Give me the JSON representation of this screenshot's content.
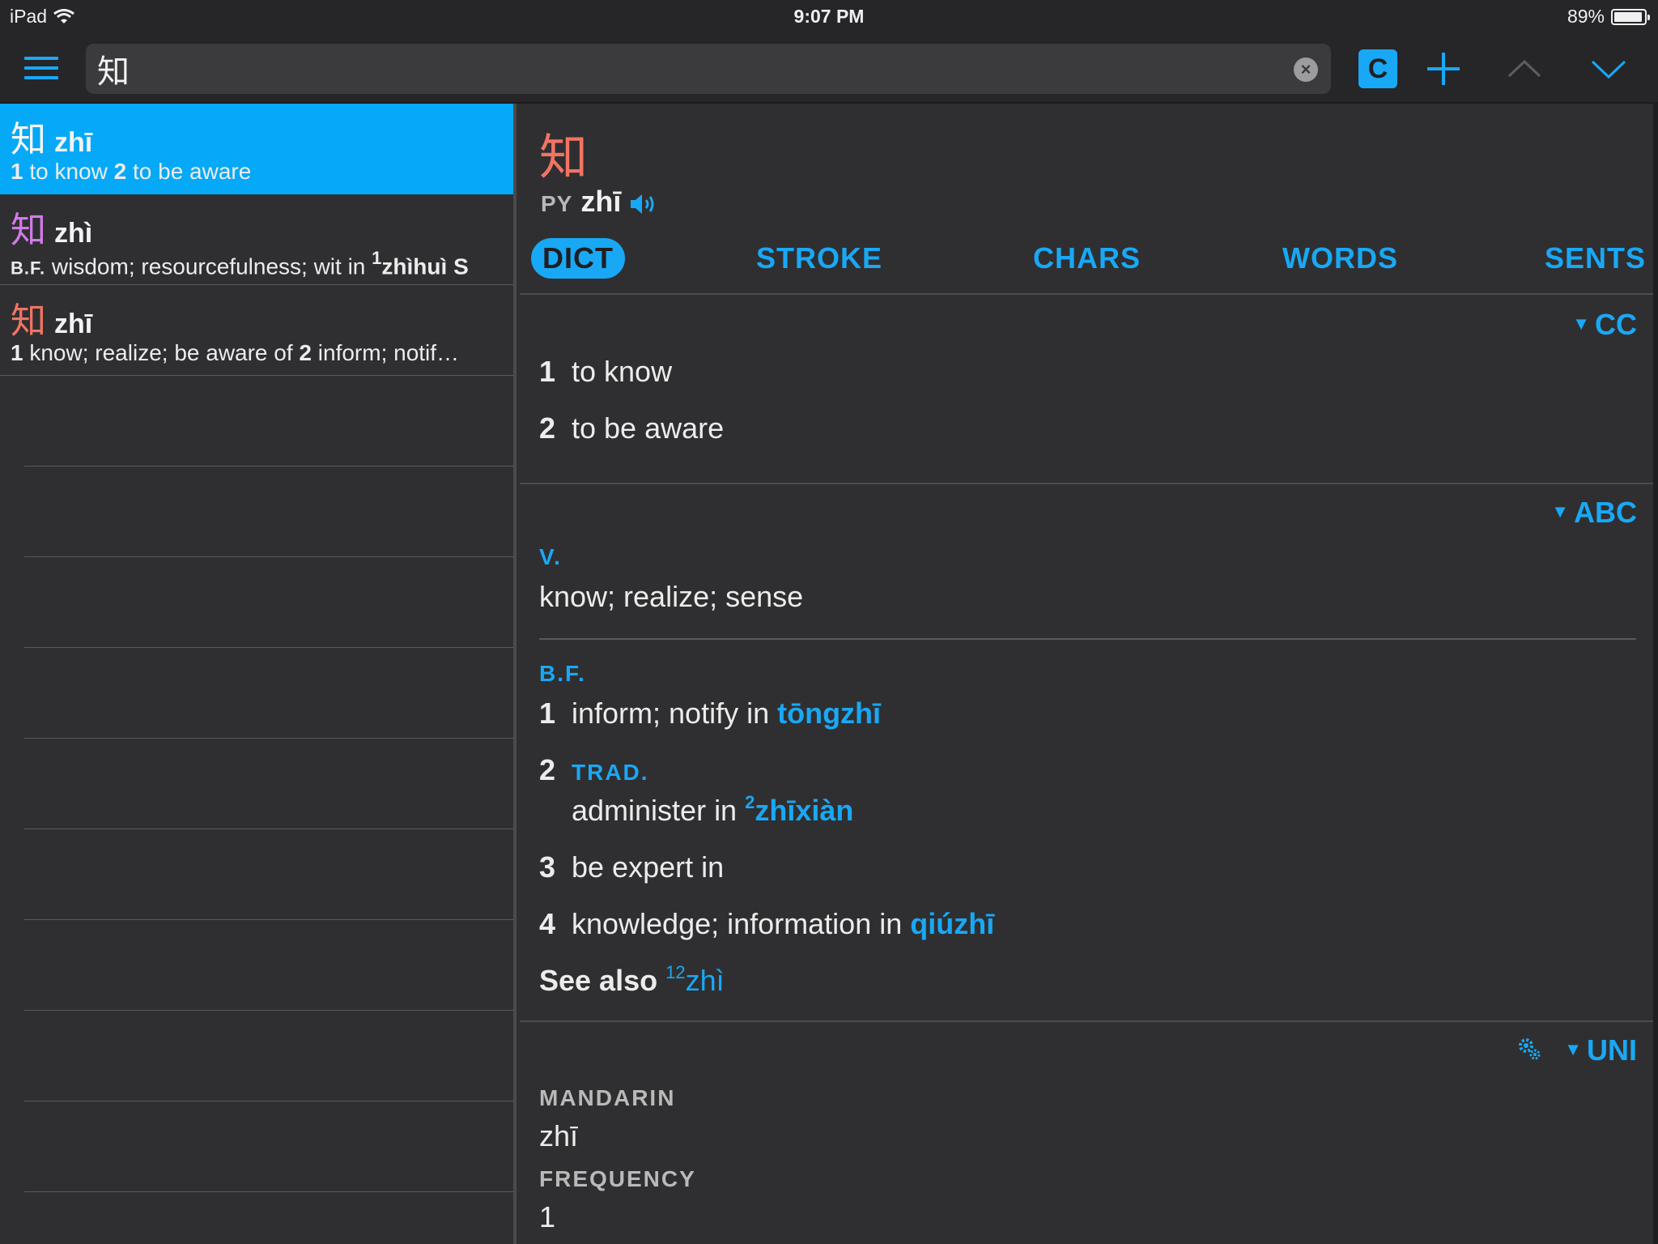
{
  "status": {
    "device": "iPad",
    "time": "9:07 PM",
    "battery": "89%"
  },
  "toolbar": {
    "query": "知",
    "c_button": "C"
  },
  "results": [
    {
      "hanzi": "知",
      "hanzi_color": "#f7f7f7",
      "pinyin": "zhī",
      "def_html_parts": {
        "n1": "1",
        "t1": " to know  ",
        "n2": "2",
        "t2": " to be aware"
      }
    },
    {
      "hanzi": "知",
      "hanzi_color": "#d27ae8",
      "pinyin": "zhì",
      "def_parts": {
        "tag": "B.F.",
        "t1": " wisdom; resourcefulness; wit in ",
        "sup": "1",
        "tail": "zhìhuì S"
      }
    },
    {
      "hanzi": "知",
      "hanzi_color": "#f27464",
      "pinyin": "zhī",
      "def_parts": {
        "n1": "1",
        "t1": " know; realize; be aware of  ",
        "n2": "2",
        "t2": " inform; notif…"
      }
    }
  ],
  "detail": {
    "hanzi": "知",
    "py_tag": "PY",
    "pinyin": "zhī",
    "tabs": [
      "DICT",
      "STROKE",
      "CHARS",
      "WORDS",
      "SENTS"
    ],
    "cc": {
      "tag": "CC",
      "senses": [
        {
          "num": "1",
          "text": "to know"
        },
        {
          "num": "2",
          "text": "to be aware"
        }
      ]
    },
    "abc": {
      "tag": "ABC",
      "pos1": "V.",
      "def1": "know; realize; sense",
      "pos2": "B.F.",
      "s1": {
        "num": "1",
        "text": "inform; notify in ",
        "link": "tōngzhī"
      },
      "s2": {
        "num": "2",
        "tag": "TRAD.",
        "text": "administer in ",
        "sup": "2",
        "link": "zhīxiàn"
      },
      "s3": {
        "num": "3",
        "text": "be expert in"
      },
      "s4": {
        "num": "4",
        "text": "knowledge; information in ",
        "link": "qiúzhī"
      },
      "see_also": "See also",
      "see_sup": "12",
      "see_link": "zhì"
    },
    "uni": {
      "tag": "UNI",
      "mandarin_label": "MANDARIN",
      "mandarin": "zhī",
      "frequency_label": "FREQUENCY",
      "frequency": "1"
    }
  },
  "colors": {
    "accent": "#19a8f5",
    "selected": "#06a9f7",
    "hanzi_red": "#f27464",
    "hanzi_purple": "#d27ae8"
  }
}
